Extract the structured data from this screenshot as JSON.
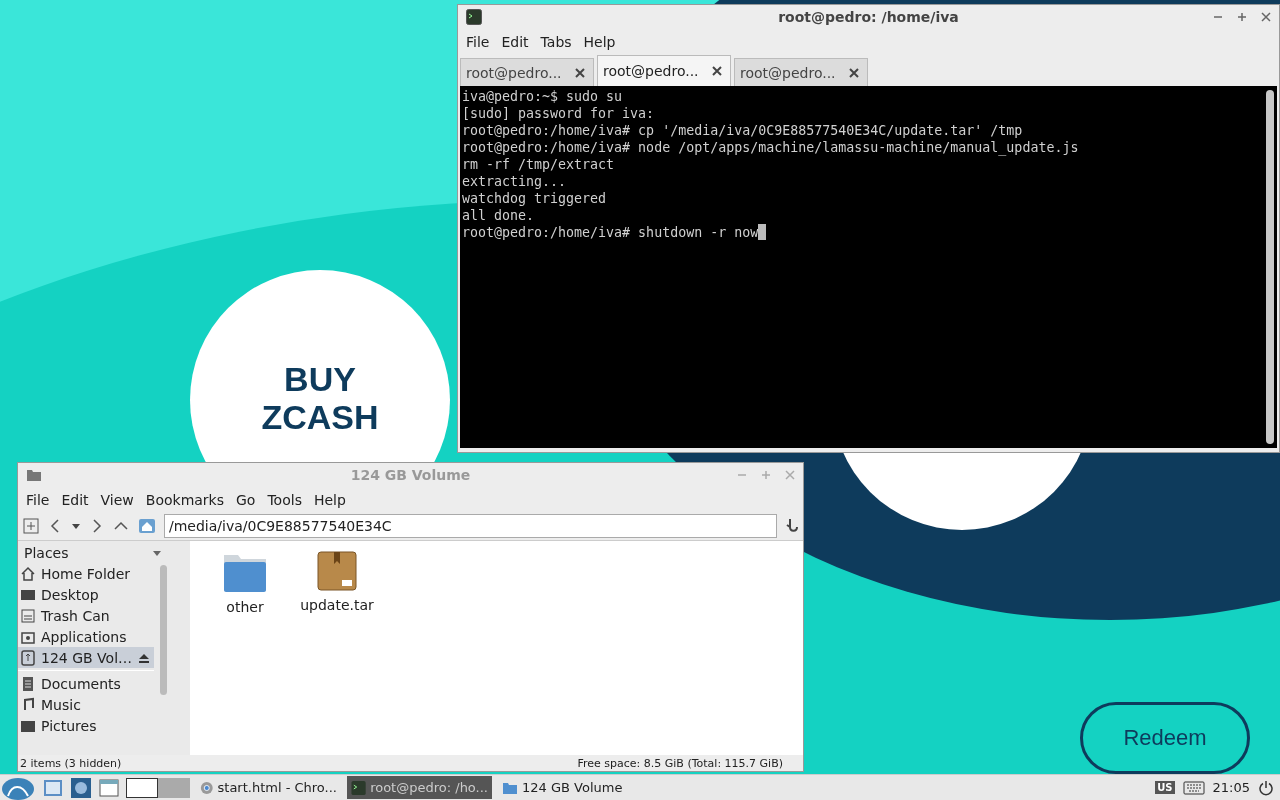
{
  "wallpaper": {
    "headline": "BUY ZCASH",
    "button": "Redeem"
  },
  "terminal": {
    "title": "root@pedro: /home/iva",
    "menu": [
      "File",
      "Edit",
      "Tabs",
      "Help"
    ],
    "tabs": [
      {
        "label": "root@pedro...",
        "selected": false
      },
      {
        "label": "root@pedro...",
        "selected": true
      },
      {
        "label": "root@pedro...",
        "selected": false
      }
    ],
    "lines": [
      "iva@pedro:~$ sudo su",
      "[sudo] password for iva:",
      "root@pedro:/home/iva# cp '/media/iva/0C9E88577540E34C/update.tar' /tmp",
      "root@pedro:/home/iva# node /opt/apps/machine/lamassu-machine/manual_update.js",
      "rm -rf /tmp/extract",
      "extracting...",
      "watchdog triggered",
      "all done.",
      "root@pedro:/home/iva# shutdown -r now"
    ]
  },
  "file_manager": {
    "title": "124 GB Volume",
    "menu": [
      "File",
      "Edit",
      "View",
      "Bookmarks",
      "Go",
      "Tools",
      "Help"
    ],
    "path": "/media/iva/0C9E88577540E34C",
    "places_label": "Places",
    "places": [
      {
        "label": "Home Folder",
        "kind": "place",
        "selected": false
      },
      {
        "label": "Desktop",
        "kind": "place",
        "selected": false
      },
      {
        "label": "Trash Can",
        "kind": "place",
        "selected": false
      },
      {
        "label": "Applications",
        "kind": "place",
        "selected": false
      },
      {
        "label": "124 GB Vol…",
        "kind": "volume",
        "selected": true
      },
      {
        "label": "Documents",
        "kind": "place",
        "selected": false
      },
      {
        "label": "Music",
        "kind": "place",
        "selected": false
      },
      {
        "label": "Pictures",
        "kind": "place",
        "selected": false
      }
    ],
    "files": [
      {
        "name": "other",
        "kind": "folder"
      },
      {
        "name": "update.tar",
        "kind": "archive"
      }
    ],
    "status_left": "2 items (3 hidden)",
    "status_right": "Free space: 8.5 GiB (Total: 115.7 GiB)"
  },
  "taskbar": {
    "tasks": [
      {
        "label": "start.html - Chro...",
        "kind": "browser",
        "selected": false
      },
      {
        "label": "root@pedro: /ho...",
        "kind": "terminal",
        "selected": true
      },
      {
        "label": "124 GB Volume",
        "kind": "folder",
        "selected": false
      }
    ],
    "layout": "US",
    "clock": "21:05"
  }
}
